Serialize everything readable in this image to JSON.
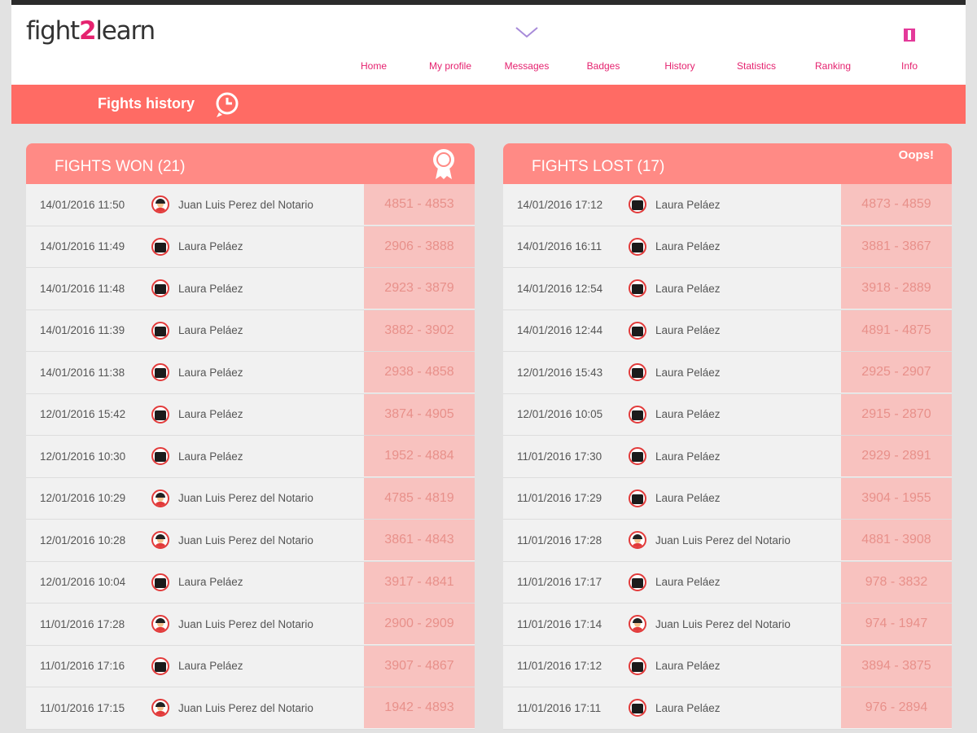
{
  "app": {
    "logo_main": "fight",
    "logo_two": "2",
    "logo_rest": "learn"
  },
  "nav": [
    {
      "label": "Home",
      "icon": "home-icon",
      "color": "#1e9ad6"
    },
    {
      "label": "My profile",
      "icon": "profile-icon",
      "color": "#f7c21b"
    },
    {
      "label": "Messages",
      "icon": "envelope-icon",
      "color": "#a78ad9"
    },
    {
      "label": "Badges",
      "icon": "badge-icon",
      "color": "#2ec478"
    },
    {
      "label": "History",
      "icon": "history-icon",
      "color": "#f2605a"
    },
    {
      "label": "Statistics",
      "icon": "statistics-icon",
      "color": "#f7913b"
    },
    {
      "label": "Ranking",
      "icon": "podium-icon",
      "color": "#f34c54"
    },
    {
      "label": "Info",
      "icon": "info-icon",
      "color": "#e43a9a"
    }
  ],
  "band": {
    "title": "Fights history"
  },
  "won": {
    "title": "FIGHTS WON (21)",
    "rows": [
      {
        "date": "14/01/2016 11:50",
        "opponent": "Juan Luis Perez del Notario",
        "avatar": "person",
        "score": "4851 - 4853"
      },
      {
        "date": "14/01/2016 11:49",
        "opponent": "Laura Peláez",
        "avatar": "dark",
        "score": "2906 - 3888"
      },
      {
        "date": "14/01/2016 11:48",
        "opponent": "Laura Peláez",
        "avatar": "dark",
        "score": "2923 - 3879"
      },
      {
        "date": "14/01/2016 11:39",
        "opponent": "Laura Peláez",
        "avatar": "dark",
        "score": "3882 - 3902"
      },
      {
        "date": "14/01/2016 11:38",
        "opponent": "Laura Peláez",
        "avatar": "dark",
        "score": "2938 - 4858"
      },
      {
        "date": "12/01/2016 15:42",
        "opponent": "Laura Peláez",
        "avatar": "dark",
        "score": "3874 - 4905"
      },
      {
        "date": "12/01/2016 10:30",
        "opponent": "Laura Peláez",
        "avatar": "dark",
        "score": "1952 - 4884"
      },
      {
        "date": "12/01/2016 10:29",
        "opponent": "Juan Luis Perez del Notario",
        "avatar": "person",
        "score": "4785 - 4819"
      },
      {
        "date": "12/01/2016 10:28",
        "opponent": "Juan Luis Perez del Notario",
        "avatar": "person",
        "score": "3861 - 4843"
      },
      {
        "date": "12/01/2016 10:04",
        "opponent": "Laura Peláez",
        "avatar": "dark",
        "score": "3917 - 4841"
      },
      {
        "date": "11/01/2016 17:28",
        "opponent": "Juan Luis Perez del Notario",
        "avatar": "person",
        "score": "2900 - 2909"
      },
      {
        "date": "11/01/2016 17:16",
        "opponent": "Laura Peláez",
        "avatar": "dark",
        "score": "3907 - 4867"
      },
      {
        "date": "11/01/2016 17:15",
        "opponent": "Juan Luis Perez del Notario",
        "avatar": "person",
        "score": "1942 - 4893"
      }
    ]
  },
  "lost": {
    "title": "FIGHTS LOST (17)",
    "badge": "Oops!",
    "rows": [
      {
        "date": "14/01/2016 17:12",
        "opponent": "Laura Peláez",
        "avatar": "dark",
        "score": "4873 - 4859"
      },
      {
        "date": "14/01/2016 16:11",
        "opponent": "Laura Peláez",
        "avatar": "dark",
        "score": "3881 - 3867"
      },
      {
        "date": "14/01/2016 12:54",
        "opponent": "Laura Peláez",
        "avatar": "dark",
        "score": "3918 - 2889"
      },
      {
        "date": "14/01/2016 12:44",
        "opponent": "Laura Peláez",
        "avatar": "dark",
        "score": "4891 - 4875"
      },
      {
        "date": "12/01/2016 15:43",
        "opponent": "Laura Peláez",
        "avatar": "dark",
        "score": "2925 - 2907"
      },
      {
        "date": "12/01/2016 10:05",
        "opponent": "Laura Peláez",
        "avatar": "dark",
        "score": "2915 - 2870"
      },
      {
        "date": "11/01/2016 17:30",
        "opponent": "Laura Peláez",
        "avatar": "dark",
        "score": "2929 - 2891"
      },
      {
        "date": "11/01/2016 17:29",
        "opponent": "Laura Peláez",
        "avatar": "dark",
        "score": "3904 - 1955"
      },
      {
        "date": "11/01/2016 17:28",
        "opponent": "Juan Luis Perez del Notario",
        "avatar": "person",
        "score": "4881 - 3908"
      },
      {
        "date": "11/01/2016 17:17",
        "opponent": "Laura Peláez",
        "avatar": "dark",
        "score": "978 - 3832"
      },
      {
        "date": "11/01/2016 17:14",
        "opponent": "Juan Luis Perez del Notario",
        "avatar": "person",
        "score": "974 - 1947"
      },
      {
        "date": "11/01/2016 17:12",
        "opponent": "Laura Peláez",
        "avatar": "dark",
        "score": "3894 - 3875"
      },
      {
        "date": "11/01/2016 17:11",
        "opponent": "Laura Peláez",
        "avatar": "dark",
        "score": "976 - 2894"
      }
    ]
  }
}
